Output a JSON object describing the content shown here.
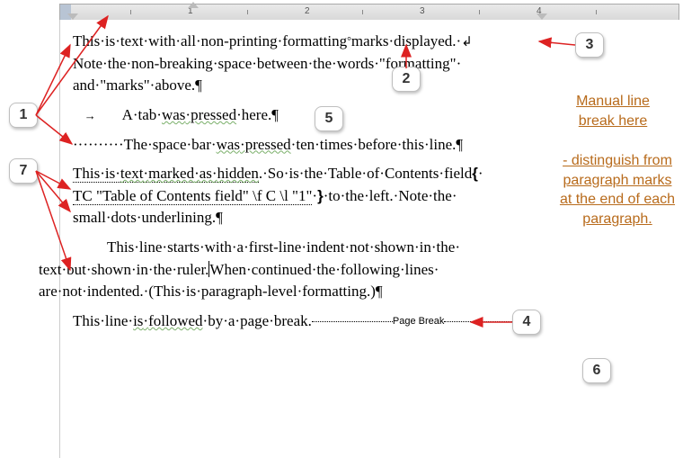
{
  "ruler": {
    "nums": [
      "1",
      "2",
      "3",
      "4"
    ]
  },
  "p1": {
    "seg1": "This",
    "seg2": "is",
    "seg3": "text",
    "seg4": "with",
    "seg5": "all",
    "seg6": "non-printing",
    "seg7": "formatting",
    "seg8": "marks",
    "seg9": "displayed.",
    "l2a": "Note",
    "l2b": "the",
    "l2c": "non-breaking",
    "l2d": "space",
    "l2e": "between",
    "l2f": "the",
    "l2g": "words",
    "l2h": "\"formatting\"",
    "l3a": "and",
    "l3b": "\"marks\"",
    "l3c": "above."
  },
  "p2": {
    "a": "A",
    "b": "tab",
    "c": "was",
    "d": "pressed",
    "e": "here."
  },
  "p3": {
    "a": "The",
    "b": "space",
    "c": "bar",
    "d": "was",
    "e": "pressed",
    "f": "ten",
    "g": "times",
    "h": "before",
    "i": "this",
    "j": "line."
  },
  "p4": {
    "a": "This",
    "b": "is",
    "c": "text",
    "d": "marked",
    "e": "as",
    "f": "hidden",
    "g": ".",
    "h": "So",
    "i": "is",
    "j": "the",
    "k": "Table",
    "l": "of",
    "m": "Contents",
    "n": "field",
    "code": "TC \"Table of Contents field\" \\f C \\l \"1\"",
    "o": "to",
    "p": "the",
    "q": "left.",
    "r": "Note",
    "s": "the",
    "t": "small",
    "u": "dots",
    "v": "underlining."
  },
  "p5": {
    "a": "This",
    "b": "line",
    "c": "starts",
    "d": "with",
    "e": "a",
    "f": "first-line",
    "g": "indent",
    "h": "not",
    "i": "shown",
    "j": "in",
    "k": "the",
    "l": "text",
    "m": "but",
    "n": "shown",
    "o": "in",
    "p": "the",
    "q": "ruler.",
    "r": "When",
    "s": "continued",
    "t": "the",
    "u": "following",
    "v": "lines",
    "w": "are",
    "x": "not",
    "y": "indented.",
    "z": "(This",
    "aa": "is",
    "bb": "paragraph-level",
    "cc": "formatting.)"
  },
  "p6": {
    "a": "This",
    "b": "line",
    "c": "is",
    "d": "followed",
    "e": "by",
    "f": "a",
    "g": "page",
    "h": "break.",
    "pb": "Page Break"
  },
  "callouts": {
    "c1": "1",
    "c2": "2",
    "c3": "3",
    "c4": "4",
    "c5": "5",
    "c6": "6",
    "c7": "7"
  },
  "notes": {
    "n1": "Manual line break here",
    "n2": "- distinguish from paragraph marks at the end of each paragraph."
  }
}
